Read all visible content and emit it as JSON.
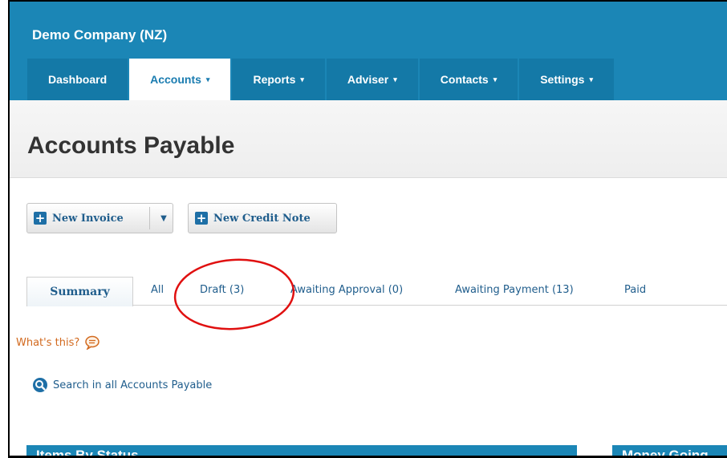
{
  "header": {
    "org_name": "Demo Company (NZ)",
    "nav": [
      {
        "label": "Dashboard",
        "caret": ""
      },
      {
        "label": "Accounts",
        "caret": "▾",
        "active": true
      },
      {
        "label": "Reports",
        "caret": "▾"
      },
      {
        "label": "Adviser",
        "caret": "▾"
      },
      {
        "label": "Contacts",
        "caret": "▾"
      },
      {
        "label": "Settings",
        "caret": "▾"
      }
    ]
  },
  "page": {
    "title": "Accounts Payable"
  },
  "actions": {
    "new_invoice": "New Invoice",
    "new_credit_note": "New Credit Note",
    "dropdown_caret": "▼"
  },
  "tabs": {
    "summary": "Summary",
    "all": "All",
    "draft": "Draft (3)",
    "awaiting_approval": "Awaiting Approval (0)",
    "awaiting_payment": "Awaiting Payment (13)",
    "paid": "Paid"
  },
  "help": {
    "whats_this": "What's this?"
  },
  "search": {
    "label": "Search in all Accounts Payable"
  },
  "panels": {
    "items_by_status": "Items By Status",
    "money_going": "Money Going"
  },
  "icons": {
    "plus": "plus-icon",
    "speech": "speech-bubble-icon",
    "search": "search-icon",
    "help": "help-icon"
  },
  "colors": {
    "brand": "#1b86b6",
    "link": "#1f5d8c",
    "accent_orange": "#d2691e",
    "annotation": "#e01010"
  }
}
